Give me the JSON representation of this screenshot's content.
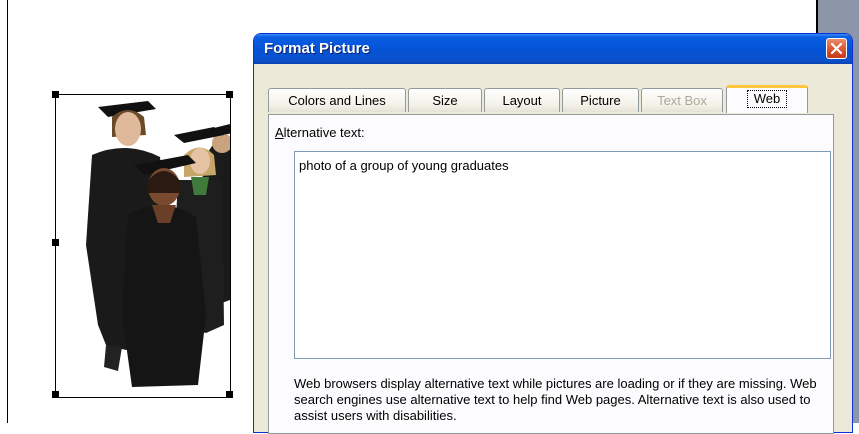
{
  "dialog": {
    "title": "Format Picture",
    "tabs": [
      {
        "label": "Colors and Lines",
        "state": "normal"
      },
      {
        "label": "Size",
        "state": "normal"
      },
      {
        "label": "Layout",
        "state": "normal"
      },
      {
        "label": "Picture",
        "state": "normal"
      },
      {
        "label": "Text Box",
        "state": "disabled"
      },
      {
        "label": "Web",
        "state": "active"
      }
    ],
    "web": {
      "alt_label_hotkey": "A",
      "alt_label_rest": "lternative text:",
      "alt_text_value": "photo of a group of young graduates",
      "help_text": "Web browsers display alternative text while pictures are loading or if they are missing.   Web search engines use alternative text to help find Web pages.   Alternative text is also used to assist users with disabilities."
    }
  },
  "icons": {
    "close": "close-icon"
  },
  "colors": {
    "titlebar": "#0554d8",
    "dialog_bg": "#ece9d8",
    "active_tab_accent": "#ffc83c",
    "close_button": "#d9502d"
  }
}
